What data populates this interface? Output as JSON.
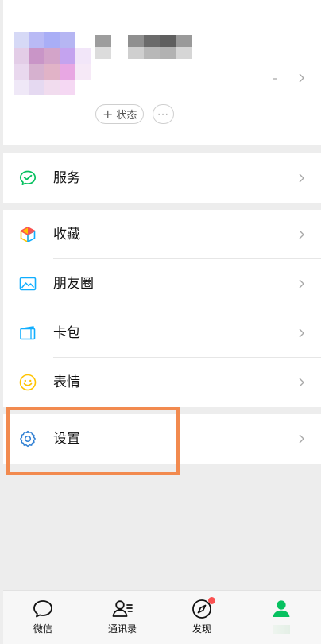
{
  "colors": {
    "accent_green": "#07c160",
    "highlight_orange": "#f28a4f",
    "badge_red": "#fa5151",
    "background": "#ededed"
  },
  "profile": {
    "status_label": "状态",
    "status_plus": "+",
    "more_label": "···",
    "avatar_icon": "blurred-avatar",
    "chevron_icon": "chevron-right-icon"
  },
  "menu": {
    "service": {
      "label": "服务",
      "icon": "wechat-pay-icon"
    },
    "favorites": {
      "label": "收藏",
      "icon": "cube-icon"
    },
    "moments": {
      "label": "朋友圈",
      "icon": "photo-icon"
    },
    "cards": {
      "label": "卡包",
      "icon": "card-wallet-icon"
    },
    "stickers": {
      "label": "表情",
      "icon": "smiley-icon"
    },
    "settings": {
      "label": "设置",
      "icon": "gear-icon"
    }
  },
  "tabbar": {
    "chats": {
      "label": "微信",
      "icon": "chat-bubble-icon"
    },
    "contacts": {
      "label": "通讯录",
      "icon": "contacts-icon"
    },
    "discover": {
      "label": "发现",
      "icon": "compass-icon",
      "has_badge": true
    },
    "me": {
      "label": "",
      "icon": "person-icon",
      "active": true
    }
  }
}
